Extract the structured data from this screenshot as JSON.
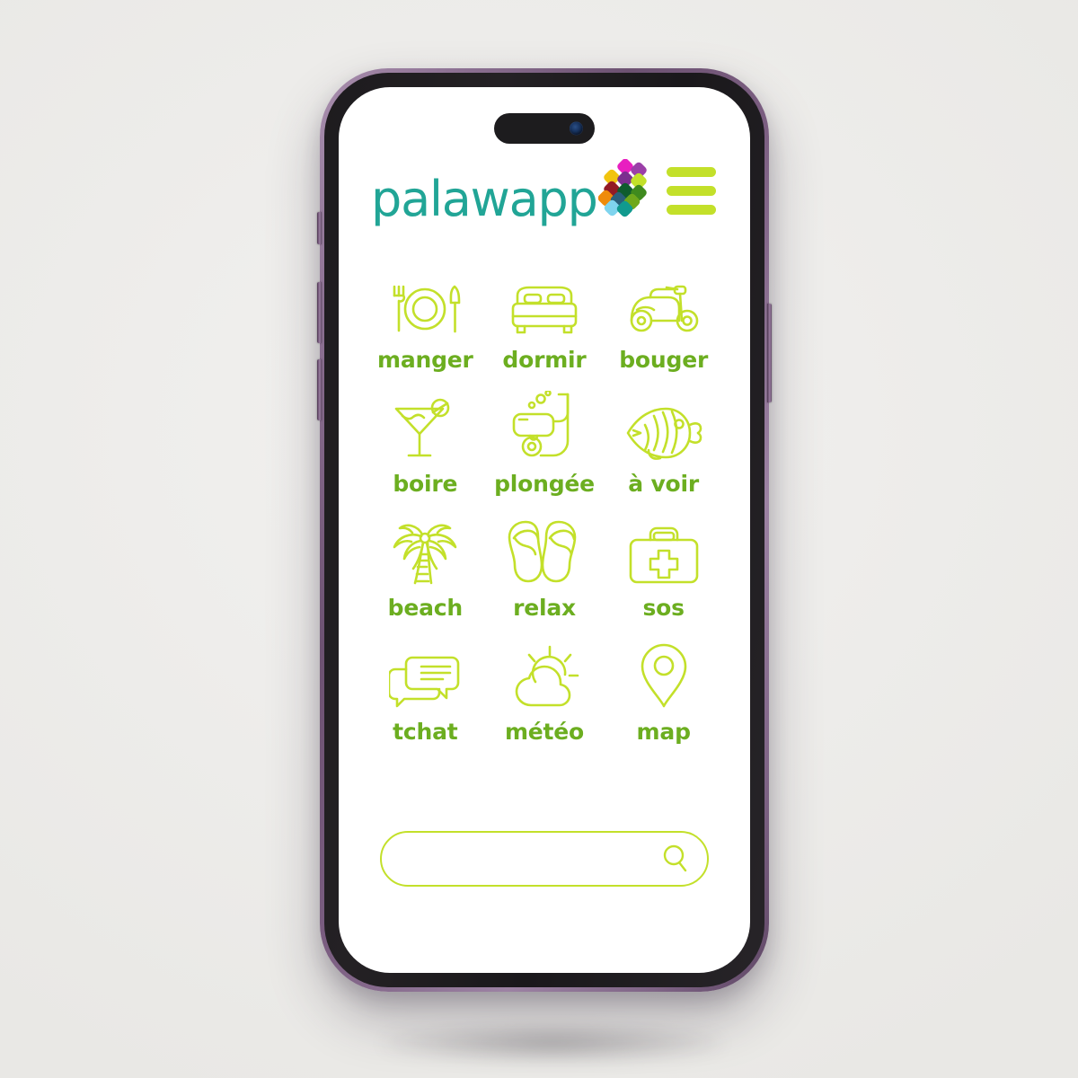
{
  "device": {
    "type": "smartphone-mockup",
    "frame_color": "#7a5d80",
    "bezel_color": "#1d1b1e",
    "screen_bg": "#ffffff",
    "buttons": [
      {
        "name": "silence-switch",
        "side": "left"
      },
      {
        "name": "volume-up-button",
        "side": "left"
      },
      {
        "name": "volume-down-button",
        "side": "left"
      },
      {
        "name": "power-button",
        "side": "right"
      }
    ]
  },
  "page_background": "#eeedeb",
  "header": {
    "brand_name": "palawapp",
    "brand_color": "#21a596",
    "menu_label": "menu",
    "menu_color": "#c3e02a",
    "logo_diamond_colors": [
      "#e81fc0",
      "#9b3fa8",
      "#f1c40f",
      "#7b2f8f",
      "#c3e02a",
      "#931a24",
      "#0f5c2e",
      "#3f8a1e",
      "#ef8b0b",
      "#2a5f7a",
      "#6fa81c",
      "#7fd4ee",
      "#119a8e"
    ]
  },
  "accent_colors": {
    "icon_green": "#c3e02a",
    "label_green": "#6cae20",
    "teal": "#21a596"
  },
  "grid": {
    "items": [
      {
        "label": "manger",
        "icon": "cutlery-plate-icon"
      },
      {
        "label": "dormir",
        "icon": "bed-icon"
      },
      {
        "label": "bouger",
        "icon": "scooter-icon"
      },
      {
        "label": "boire",
        "icon": "cocktail-glass-icon"
      },
      {
        "label": "plongée",
        "icon": "snorkel-mask-icon"
      },
      {
        "label": "à voir",
        "icon": "tropical-fish-icon"
      },
      {
        "label": "beach",
        "icon": "palm-tree-icon"
      },
      {
        "label": "relax",
        "icon": "flip-flops-icon"
      },
      {
        "label": "sos",
        "icon": "first-aid-kit-icon"
      },
      {
        "label": "tchat",
        "icon": "chat-bubbles-icon"
      },
      {
        "label": "météo",
        "icon": "sun-cloud-icon"
      },
      {
        "label": "map",
        "icon": "location-pin-icon"
      }
    ]
  },
  "search": {
    "value": "",
    "placeholder": "",
    "icon": "magnifier-icon"
  }
}
